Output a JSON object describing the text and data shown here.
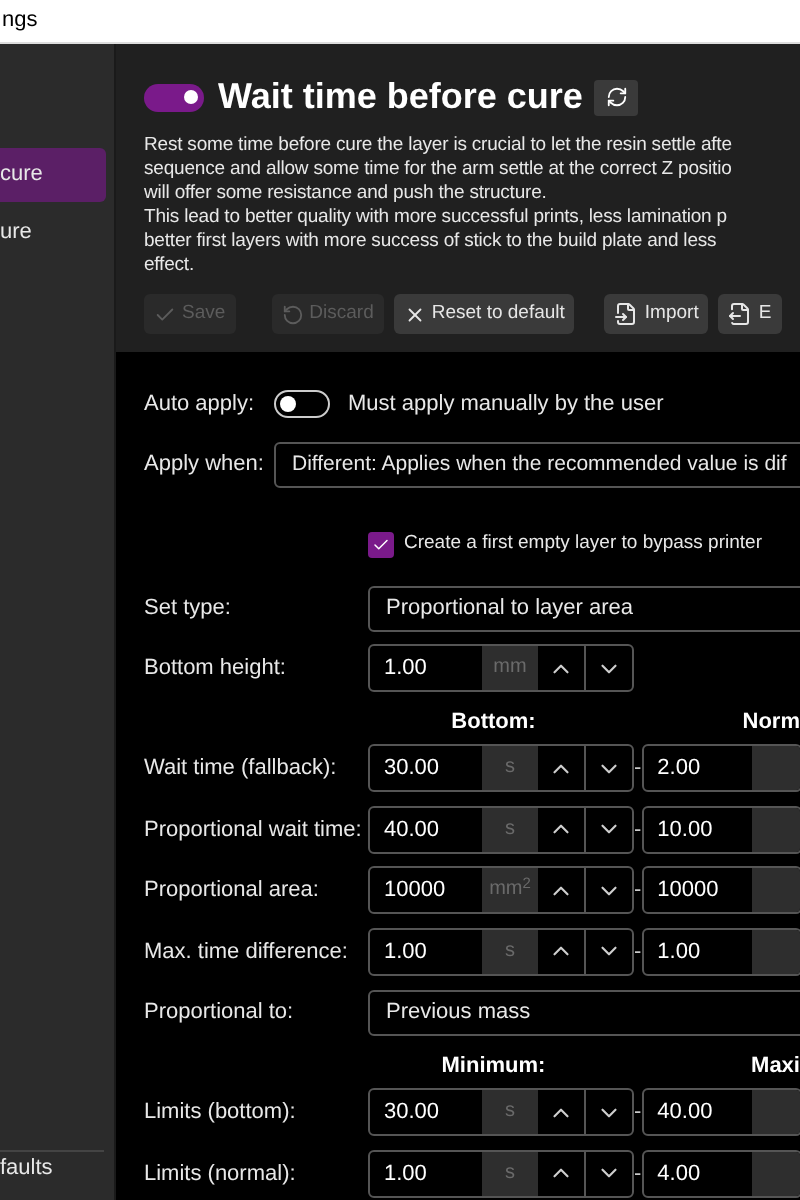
{
  "window": {
    "title": "ngs"
  },
  "sidebar": {
    "items": [
      {
        "label": "cure",
        "selected": true
      },
      {
        "label": "ure",
        "selected": false
      }
    ],
    "footer": "faults"
  },
  "header": {
    "enabled": true,
    "title": "Wait time before cure",
    "description": [
      "Rest some time before cure the layer is crucial to let the resin settle afte",
      "sequence and allow some time for the arm settle at the correct Z positio",
      "will offer some resistance and push the structure.",
      "This lead to better quality with more successful prints, less lamination p",
      "better first layers with more success of stick to the build plate and less",
      "effect."
    ],
    "buttons": [
      {
        "kind": "save",
        "label": "Save",
        "disabled": true
      },
      {
        "kind": "discard",
        "label": "Discard",
        "disabled": true
      },
      {
        "kind": "reset",
        "label": "Reset to default",
        "disabled": false
      },
      {
        "kind": "import",
        "label": "Import",
        "disabled": false
      },
      {
        "kind": "export",
        "label": "E",
        "disabled": false
      }
    ]
  },
  "form": [
    {
      "kind": "toggle",
      "label": "Auto apply:",
      "on": false,
      "text": "Must apply manually by the user"
    },
    {
      "kind": "wideselect",
      "label": "Apply when:",
      "value": "Different: Applies when the recommended value is dif"
    },
    {
      "kind": "checkbox",
      "checked": true,
      "text": "Create a first empty layer to bypass printer"
    },
    {
      "kind": "select",
      "label": "Set type:",
      "value": "Proportional to layer area"
    },
    {
      "kind": "number",
      "label": "Bottom height:",
      "value": "1.00",
      "unit": "mm"
    },
    {
      "kind": "header",
      "left": "Bottom:",
      "right": "Norm"
    },
    {
      "kind": "range",
      "label": "Wait time (fallback):",
      "value": "30.00",
      "unit": "s",
      "separator": "-",
      "value2": "2.00"
    },
    {
      "kind": "range",
      "label": "Proportional wait time:",
      "value": "40.00",
      "unit": "s",
      "separator": "-",
      "value2": "10.00"
    },
    {
      "kind": "range",
      "label": "Proportional area:",
      "value": "10000",
      "unit": "mm$^{2}$",
      "separator": "-",
      "value2": "10000"
    },
    {
      "kind": "range",
      "label": "Max. time difference:",
      "value": "1.00",
      "unit": "s",
      "separator": "-",
      "value2": "1.00"
    },
    {
      "kind": "select",
      "label": "Proportional to:",
      "value": "Previous mass"
    },
    {
      "kind": "header",
      "left": "Minimum:",
      "right": "Maxi"
    },
    {
      "kind": "range",
      "label": "Limits (bottom):",
      "value": "30.00",
      "unit": "s",
      "separator": "-",
      "value2": "40.00"
    },
    {
      "kind": "range",
      "label": "Limits (normal):",
      "value": "1.00",
      "unit": "s",
      "separator": "-",
      "value2": "4.00"
    }
  ]
}
